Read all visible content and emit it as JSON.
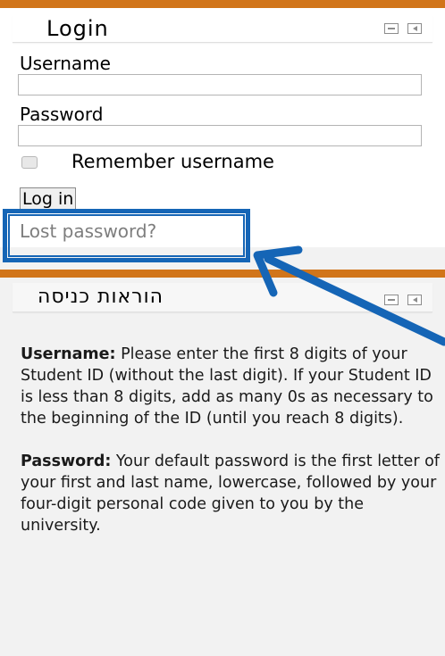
{
  "login_block": {
    "title": "Login",
    "username_label": "Username",
    "username_value": "",
    "password_label": "Password",
    "password_value": "",
    "remember_label": "Remember username",
    "remember_checked": false,
    "login_button": "Log in",
    "lost_password_link": "Lost password?"
  },
  "instructions_block": {
    "title": "הוראות כניסה",
    "username_heading": "Username:",
    "username_text": " Please enter the first 8 digits of your Student ID (without the last digit). If your Student ID is less than 8 digits, add as many 0s as necessary to the beginning of the ID (until you reach 8 digits).",
    "password_heading": "Password:",
    "password_text": " Your default password is the first letter of your first and last name, lowercase, followed by your four-digit personal code given to you by the university."
  },
  "colors": {
    "header_bar": "#d1751a",
    "annotation": "#1565b6"
  }
}
